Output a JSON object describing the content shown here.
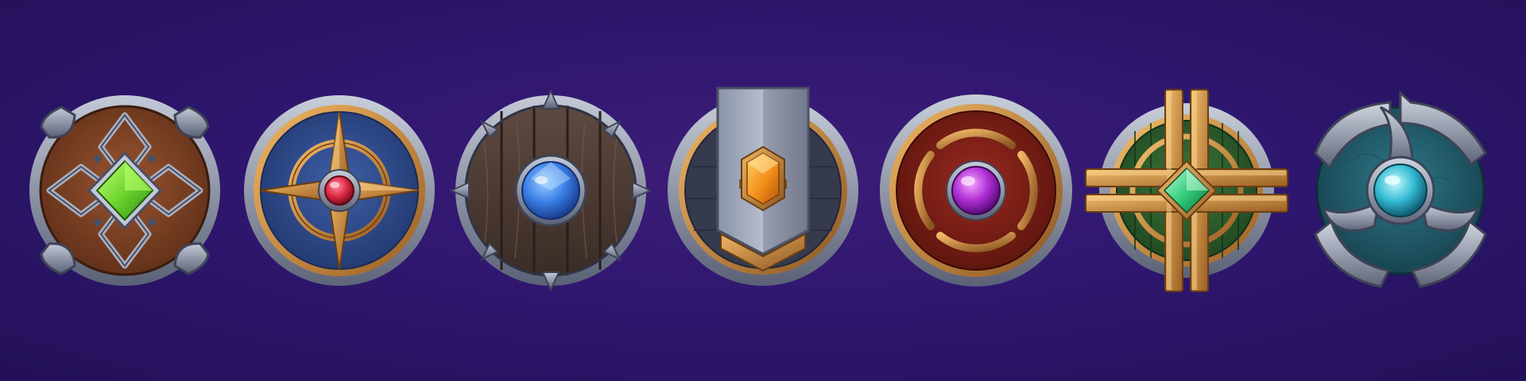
{
  "palette": {
    "background": "#2f1770",
    "steel": "#8b93a8",
    "steel_light": "#c3c9d6",
    "steel_dark": "#4f566a",
    "gold": "#d49a44",
    "gold_dark": "#8a5a22",
    "wood_brown": "#7a3f24",
    "navy": "#2f4a8c",
    "dark_wood": "#4a3b34",
    "dark_slate": "#3a3f52",
    "crimson": "#7a1f18",
    "forest": "#2f5a2e",
    "teal": "#1f5a6a"
  },
  "shields": [
    {
      "id": "shield-1",
      "icon": "celtic-knot-shield-icon",
      "gem_color": "#7be03a",
      "gem_shape": "diamond"
    },
    {
      "id": "shield-2",
      "icon": "compass-star-shield-icon",
      "gem_color": "#e0334e",
      "gem_shape": "round"
    },
    {
      "id": "shield-3",
      "icon": "wooden-plank-shield-icon",
      "gem_color": "#3f86ee",
      "gem_shape": "round"
    },
    {
      "id": "shield-4",
      "icon": "banner-shield-icon",
      "gem_color": "#f29a12",
      "gem_shape": "hexagon"
    },
    {
      "id": "shield-5",
      "icon": "crosshair-shield-icon",
      "gem_color": "#b238d8",
      "gem_shape": "round"
    },
    {
      "id": "shield-6",
      "icon": "golden-cross-shield-icon",
      "gem_color": "#3fd88a",
      "gem_shape": "diamond"
    },
    {
      "id": "shield-7",
      "icon": "triskelion-shield-icon",
      "gem_color": "#3cc8dc",
      "gem_shape": "round"
    }
  ]
}
